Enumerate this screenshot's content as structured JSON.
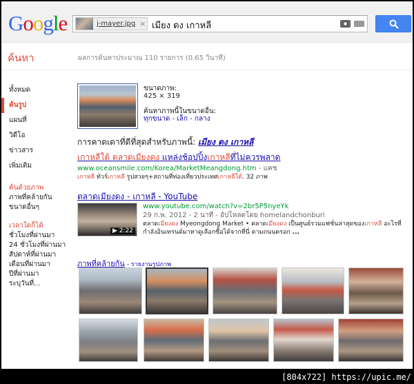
{
  "header": {
    "logo": [
      {
        "ch": "G",
        "color": "#3369e8"
      },
      {
        "ch": "o",
        "color": "#d50f25"
      },
      {
        "ch": "o",
        "color": "#eeb211"
      },
      {
        "ch": "g",
        "color": "#3369e8"
      },
      {
        "ch": "l",
        "color": "#009925"
      },
      {
        "ch": "e",
        "color": "#d50f25"
      }
    ],
    "image_chip": "j-mayer.jpg",
    "chip_close": "×",
    "query": "เมียง ดง เกาหลี"
  },
  "subbar": {
    "section_title": "ค้นหา",
    "stats": "ผลการค้นหาประมาณ 110 รายการ (0.65 วินาที)"
  },
  "leftnav": {
    "items": [
      {
        "label": "ทั้งหมด",
        "active": false
      },
      {
        "label": "ค้นรูป",
        "active": true
      },
      {
        "label": "แผนที่",
        "active": false
      },
      {
        "label": "วิดีโอ",
        "active": false
      },
      {
        "label": "ข่าวสาร",
        "active": false
      },
      {
        "label": "เพิ่มเติม",
        "active": false
      }
    ],
    "by_image_head": "ค้นด้วยภาพ",
    "by_image_items": [
      "ภาพที่คล้ายกัน",
      "ขนาดอื่นๆ"
    ],
    "time_head": "เวลาใดก็ได้",
    "time_items": [
      "ชั่วโมงที่ผ่านมา",
      "24 ชั่วโมงที่ผ่านมา",
      "สัปดาห์ที่ผ่านมา",
      "เดือนที่ผ่านมา",
      "ปีที่ผ่านมา",
      "ระบุวันที่..."
    ]
  },
  "query_image": {
    "size_label": "ขนาดภาพ:",
    "size_value": "425 × 319",
    "other_sizes_label": "ค้นหาภาพนี้ในขนาดอื่น:",
    "size_links": "ทุกขนาด - เล็ก - กลาง",
    "best_guess_prefix": "การคาดเดาที่ดีที่สุดสำหรับภาพนี้:",
    "best_guess": "เมียง ดง เกาหลี"
  },
  "results": [
    {
      "title_parts": [
        {
          "t": "เกาหลีใต้",
          "hl": true
        },
        {
          "t": " ",
          "hl": false
        },
        {
          "t": "ตลาดเมียงดง",
          "hl": true
        },
        {
          "t": " แหล่งช้อปปิ้ง",
          "hl": false
        },
        {
          "t": "เกาหลี",
          "hl": true
        },
        {
          "t": "ที่ไม่ควรพลาด",
          "hl": false
        }
      ],
      "url": "www.oceansmile.com/Korea/MarketMeangdong.htm",
      "url_suffix": " - แคช",
      "snippet_parts": [
        {
          "t": "เกาหลี",
          "hl": true
        },
        {
          "t": " ทัวร์",
          "hl": false
        },
        {
          "t": "เกาหลี",
          "hl": true
        },
        {
          "t": " รูปสวยๆ+สถานที่ท่องเที่ยวประเทศ",
          "hl": false
        },
        {
          "t": "เกาหลีใต้",
          "hl": true
        },
        {
          "t": ". 32 ภาพ",
          "hl": false
        }
      ]
    },
    {
      "title_parts": [
        {
          "t": "ตลาดเมียงดง",
          "hl": false
        },
        {
          "t": " - ",
          "hl": false
        },
        {
          "t": "เกาหลี",
          "hl": false
        },
        {
          "t": " - YouTube",
          "hl": false
        }
      ],
      "url": "www.youtube.com/watch?v=2br5P5nyeYk",
      "meta": "29 ก.พ. 2012 - 2 นาที - อัปโหลดโดย homelandchonburi",
      "snippet_parts": [
        {
          "t": "ตลาด",
          "hl": false
        },
        {
          "t": "เมียงดง",
          "hl": true
        },
        {
          "t": " Myeongdong Market • ตลาด",
          "hl": false
        },
        {
          "t": "เมียงดง",
          "hl": true
        },
        {
          "t": " เป็นศูนย์รวมแฟชั่นล่าสุดของ",
          "hl": false
        },
        {
          "t": "เกาหลี",
          "hl": true
        },
        {
          "t": " อะไรที่กำลังอินเทรนด์มาหาดูเลือกซื้อได้จากที่นี่ ตามถนนตรอก ",
          "hl": false
        },
        {
          "t": "...",
          "hl": false
        }
      ],
      "duration": "2:22"
    }
  ],
  "similar": {
    "title": "ภาพที่คล้ายกัน",
    "report": " - รายงานรูปภาพ"
  },
  "watermark": "[804x722] https://upic.me/"
}
